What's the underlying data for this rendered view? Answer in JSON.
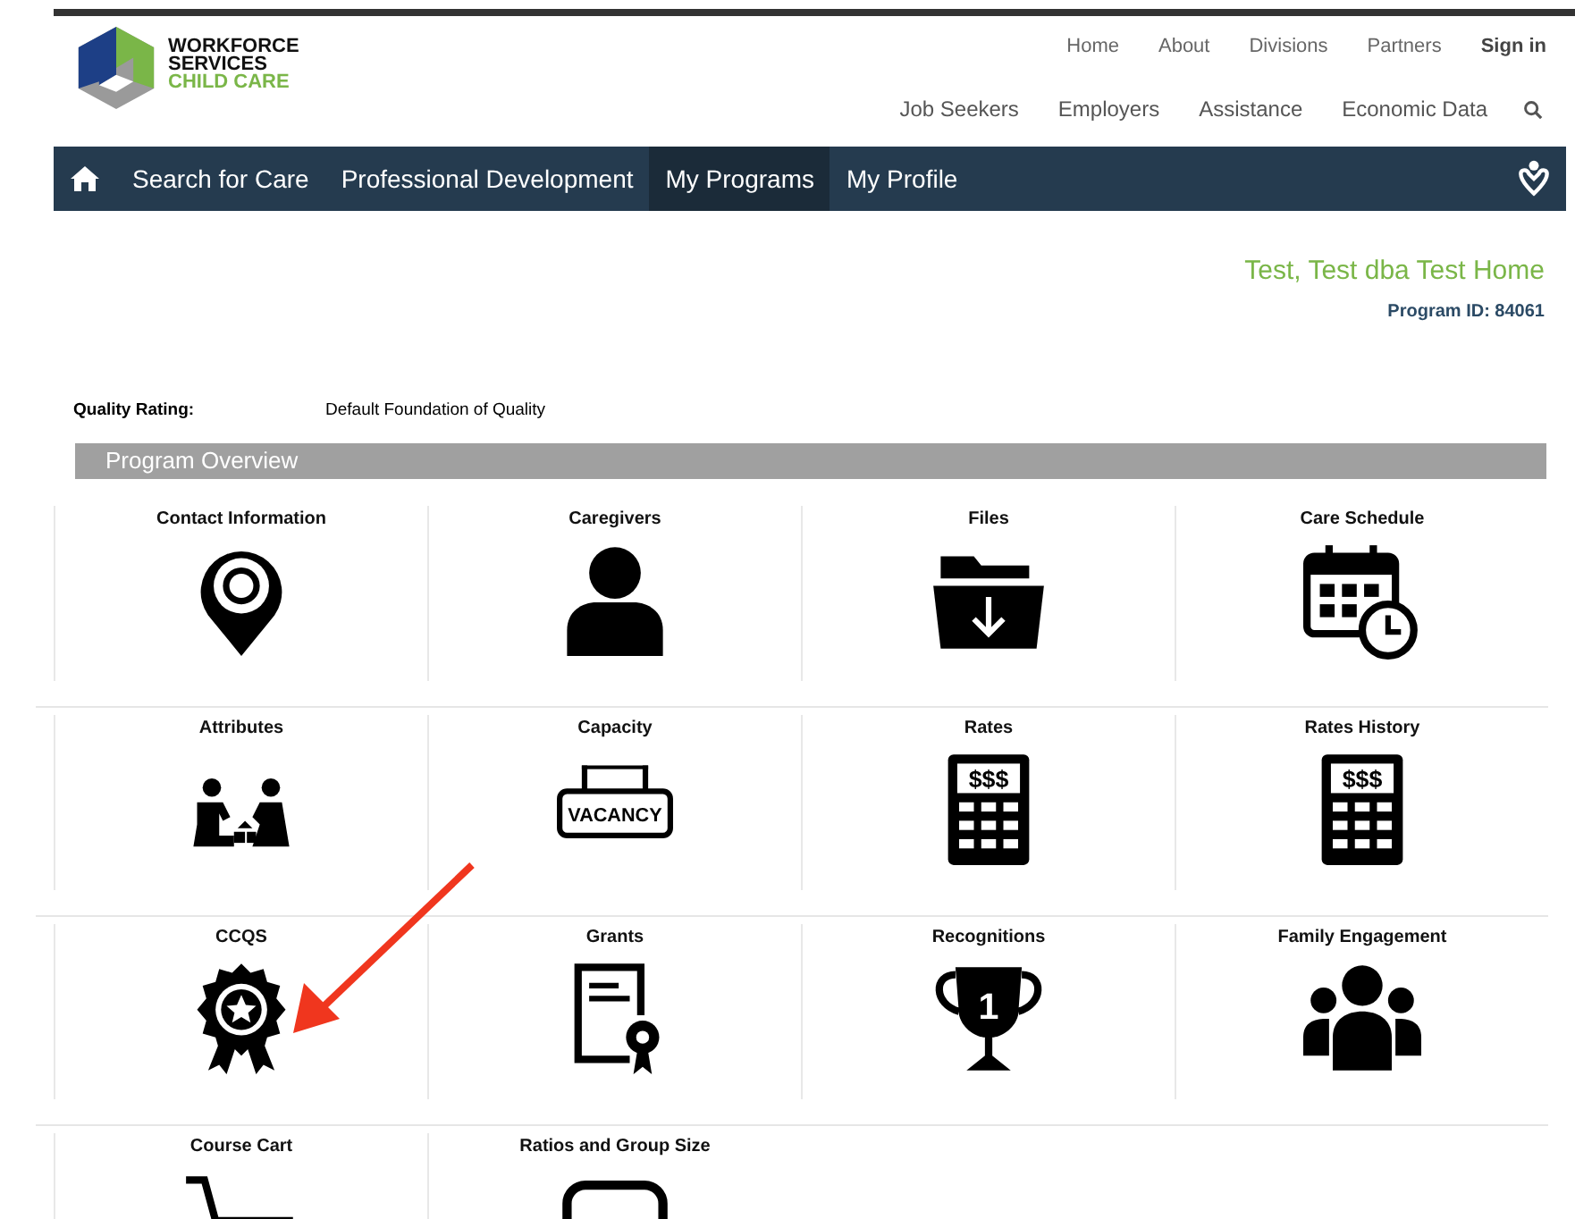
{
  "logo": {
    "line_1": "WORKFORCE",
    "line_2": "SERVICES",
    "line_3": "CHILD CARE"
  },
  "top_links": [
    {
      "label": "Home",
      "strong": false
    },
    {
      "label": "About",
      "strong": false
    },
    {
      "label": "Divisions",
      "strong": false
    },
    {
      "label": "Partners",
      "strong": false
    },
    {
      "label": "Sign in",
      "strong": true
    }
  ],
  "main_links": [
    "Job Seekers",
    "Employers",
    "Assistance",
    "Economic Data"
  ],
  "nav": [
    {
      "label": "Search for Care",
      "selected": false
    },
    {
      "label": "Professional Development",
      "selected": false
    },
    {
      "label": "My Programs",
      "selected": true
    },
    {
      "label": "My Profile",
      "selected": false
    }
  ],
  "provider": {
    "name": "Test, Test dba Test Home",
    "program_id": "Program ID: 84061"
  },
  "quality": {
    "label": "Quality Rating:",
    "value": "Default Foundation of Quality"
  },
  "section_title": "Program Overview",
  "tiles": [
    {
      "label": "Contact Information",
      "kind": "pin"
    },
    {
      "label": "Caregivers",
      "kind": "person"
    },
    {
      "label": "Files",
      "kind": "folder"
    },
    {
      "label": "Care Schedule",
      "kind": "calendar"
    },
    {
      "label": "Attributes",
      "kind": "kids"
    },
    {
      "label": "Capacity",
      "kind": "sign",
      "icon_text": "VACANCY"
    },
    {
      "label": "Rates",
      "kind": "calc",
      "icon_text": "$$$"
    },
    {
      "label": "Rates History",
      "kind": "calc",
      "icon_text": "$$$"
    },
    {
      "label": "CCQS",
      "kind": "award"
    },
    {
      "label": "Grants",
      "kind": "certificate"
    },
    {
      "label": "Recognitions",
      "kind": "trophy",
      "icon_text": "1"
    },
    {
      "label": "Family Engagement",
      "kind": "group"
    },
    {
      "label": "Course Cart",
      "kind": "cart"
    },
    {
      "label": "Ratios and Group Size",
      "kind": "box"
    }
  ]
}
